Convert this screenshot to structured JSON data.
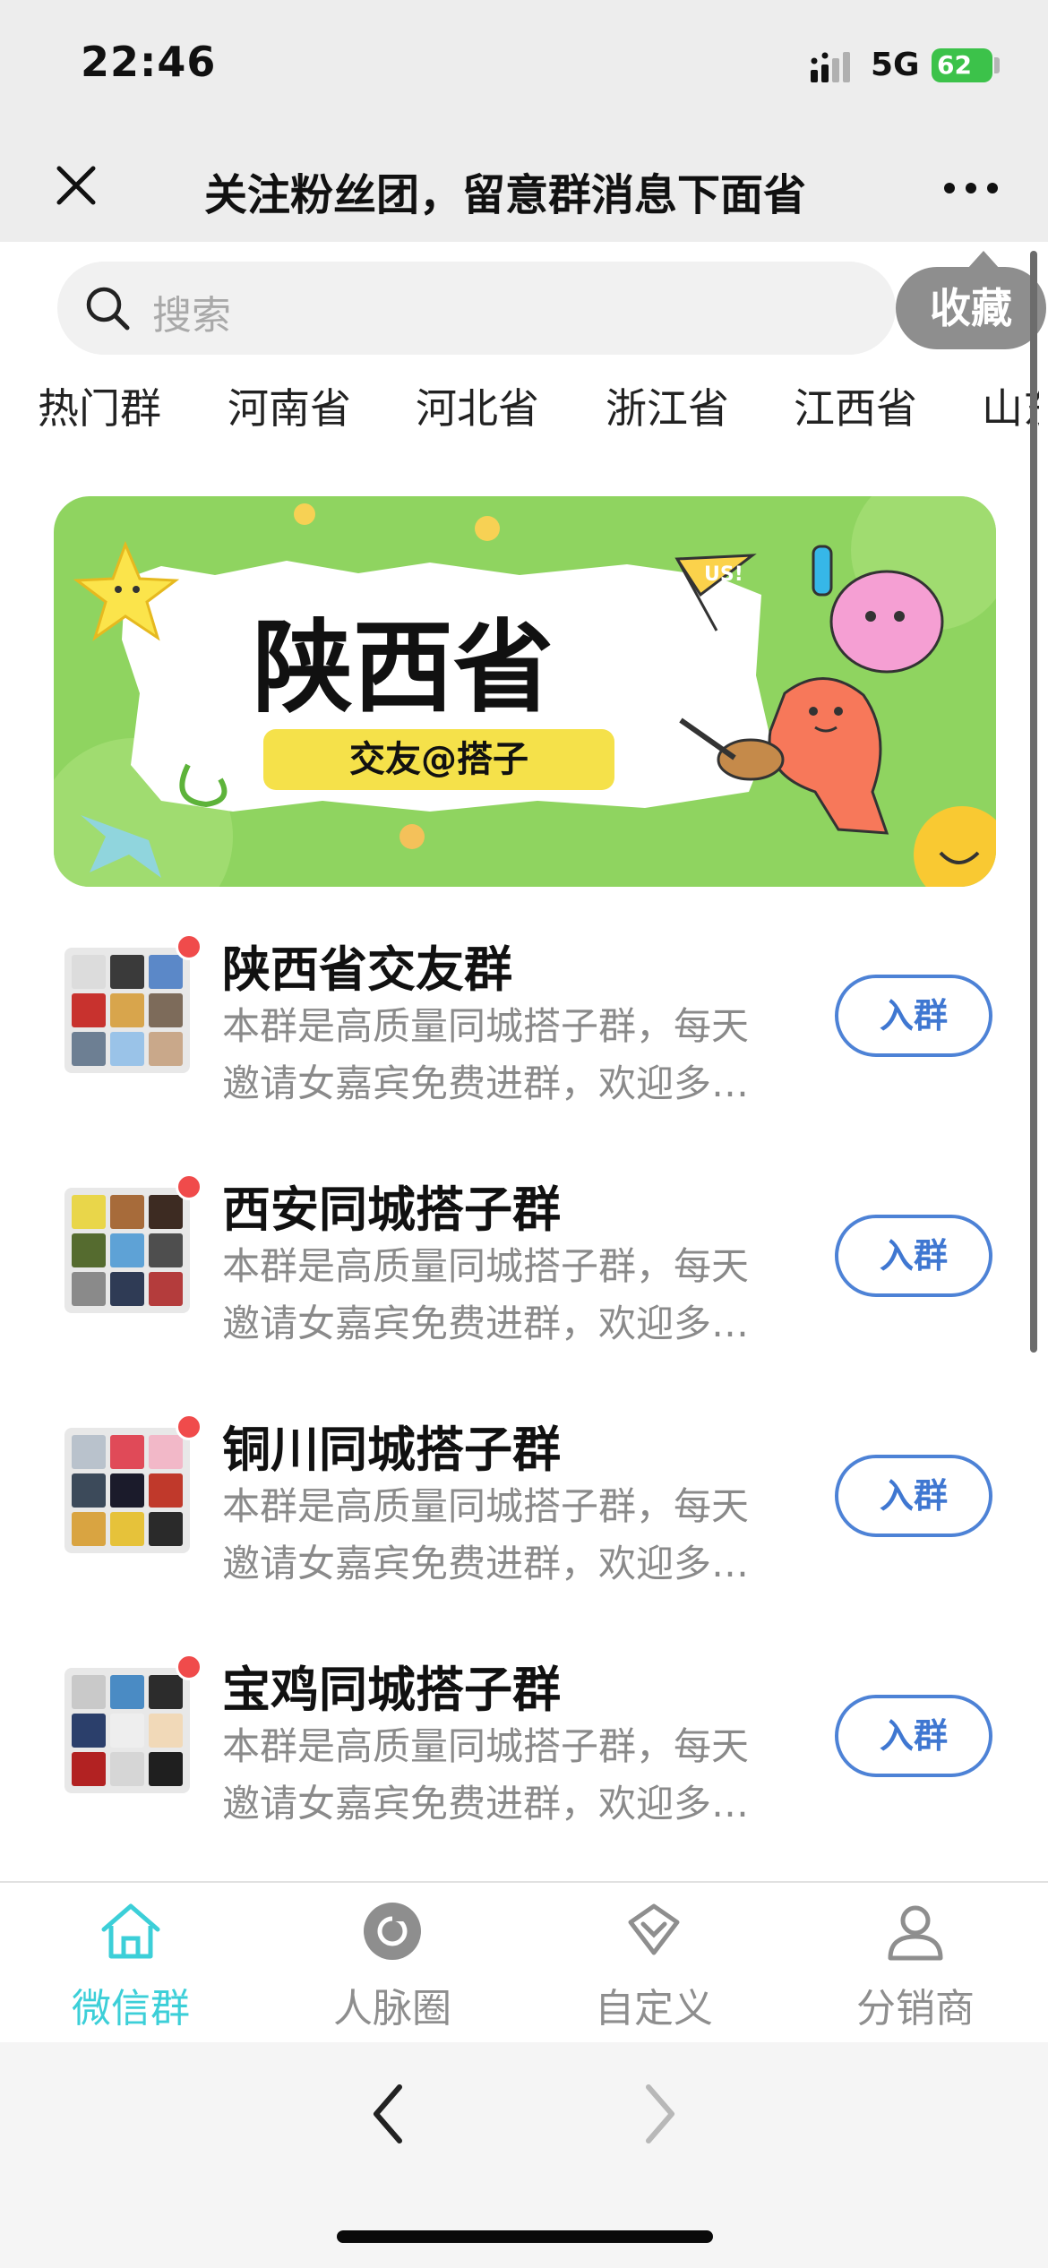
{
  "status_bar": {
    "time": "22:46",
    "network": "5G",
    "battery": "62",
    "battery_color": "#3cc24a"
  },
  "nav": {
    "title": "关注粉丝团，留意群消息下面省",
    "close_icon": "close-icon",
    "more_icon": "more-icon"
  },
  "search": {
    "placeholder": "搜索",
    "favorite_label": "收藏"
  },
  "region_tabs": [
    "热门群",
    "河南省",
    "河北省",
    "浙江省",
    "江西省",
    "山东"
  ],
  "banner": {
    "title": "陕西省",
    "subtitle": "交友@搭子",
    "flag_text": "US!"
  },
  "groups": [
    {
      "name": "陕西省交友群",
      "desc": "本群是高质量同城搭子群，每天邀请女嘉宾免费进群，欢迎多…",
      "join_label": "入群"
    },
    {
      "name": "西安同城搭子群",
      "desc": "本群是高质量同城搭子群，每天邀请女嘉宾免费进群，欢迎多…",
      "join_label": "入群"
    },
    {
      "name": "铜川同城搭子群",
      "desc": "本群是高质量同城搭子群，每天邀请女嘉宾免费进群，欢迎多…",
      "join_label": "入群"
    },
    {
      "name": "宝鸡同城搭子群",
      "desc": "本群是高质量同城搭子群，每天邀请女嘉宾免费进群，欢迎多…",
      "join_label": "入群"
    }
  ],
  "tabbar": {
    "items": [
      {
        "label": "微信群",
        "icon": "home-icon",
        "active": true
      },
      {
        "label": "人脉圈",
        "icon": "circle-icon",
        "active": false
      },
      {
        "label": "自定义",
        "icon": "diamond-icon",
        "active": false
      },
      {
        "label": "分销商",
        "icon": "person-icon",
        "active": false
      }
    ],
    "active_color": "#3ccfd8"
  },
  "browser_nav": {
    "back_icon": "chevron-left-icon",
    "forward_icon": "chevron-right-icon"
  }
}
